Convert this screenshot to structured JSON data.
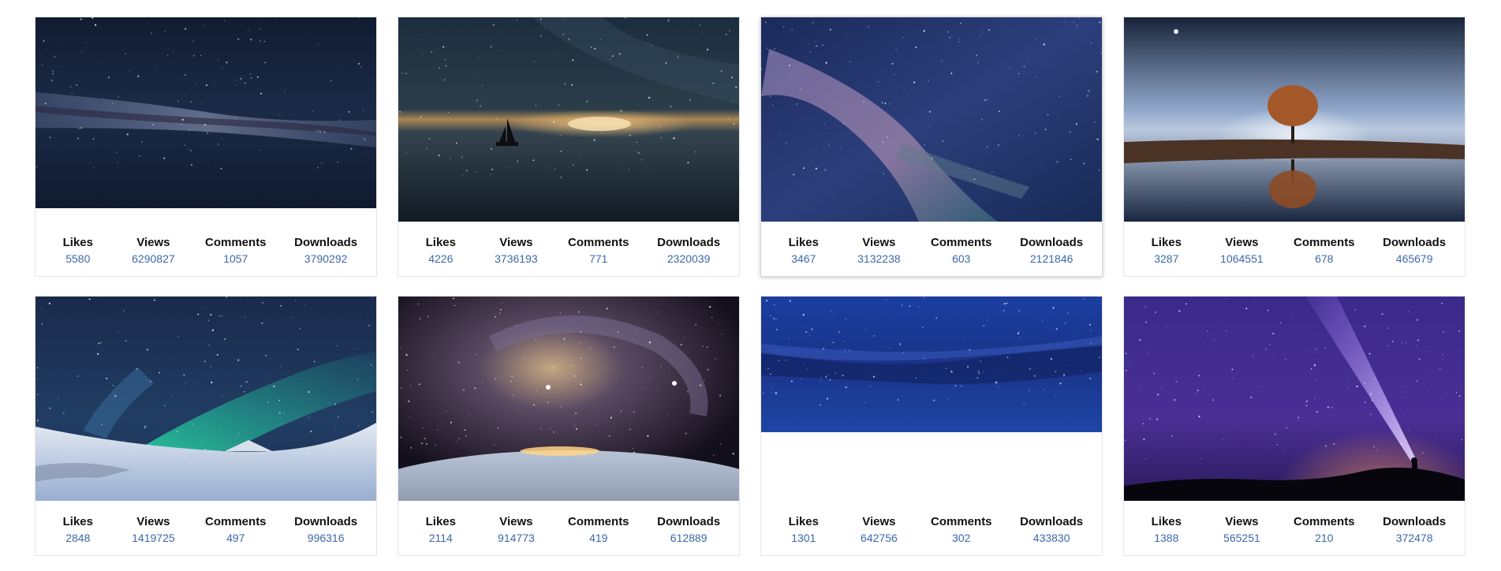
{
  "cards": [
    {
      "image": "milky-way-panorama-image",
      "likes_label": "Likes",
      "likes": "5580",
      "views_label": "Views",
      "views": "6290827",
      "comments_label": "Comments",
      "comments": "1057",
      "downloads_label": "Downloads",
      "downloads": "3790292"
    },
    {
      "image": "sailboat-night-reflection-image",
      "likes_label": "Likes",
      "likes": "4226",
      "views_label": "Views",
      "views": "3736193",
      "comments_label": "Comments",
      "comments": "771",
      "downloads_label": "Downloads",
      "downloads": "2320039"
    },
    {
      "image": "milky-way-galaxy-core-image",
      "likes_label": "Likes",
      "likes": "3467",
      "views_label": "Views",
      "views": "3132238",
      "comments_label": "Comments",
      "comments": "603",
      "downloads_label": "Downloads",
      "downloads": "2121846"
    },
    {
      "image": "lone-tree-lake-reflection-image",
      "likes_label": "Likes",
      "likes": "3287",
      "views_label": "Views",
      "views": "1064551",
      "comments_label": "Comments",
      "comments": "678",
      "downloads_label": "Downloads",
      "downloads": "465679"
    },
    {
      "image": "aurora-snow-landscape-image",
      "likes_label": "Likes",
      "likes": "2848",
      "views_label": "Views",
      "views": "1419725",
      "comments_label": "Comments",
      "comments": "497",
      "downloads_label": "Downloads",
      "downloads": "996316"
    },
    {
      "image": "planet-galaxy-space-image",
      "likes_label": "Likes",
      "likes": "2114",
      "views_label": "Views",
      "views": "914773",
      "comments_label": "Comments",
      "comments": "419",
      "downloads_label": "Downloads",
      "downloads": "612889"
    },
    {
      "image": "blue-starfield-image",
      "likes_label": "Likes",
      "likes": "1301",
      "views_label": "Views",
      "views": "642756",
      "comments_label": "Comments",
      "comments": "302",
      "downloads_label": "Downloads",
      "downloads": "433830"
    },
    {
      "image": "flashlight-beam-night-sky-image",
      "likes_label": "Likes",
      "likes": "1388",
      "views_label": "Views",
      "views": "565251",
      "comments_label": "Comments",
      "comments": "210",
      "downloads_label": "Downloads",
      "downloads": "372478"
    }
  ],
  "colors": {
    "stat_value": "#3c68a8",
    "stat_label": "#111111",
    "card_border": "#e6e6e6"
  }
}
